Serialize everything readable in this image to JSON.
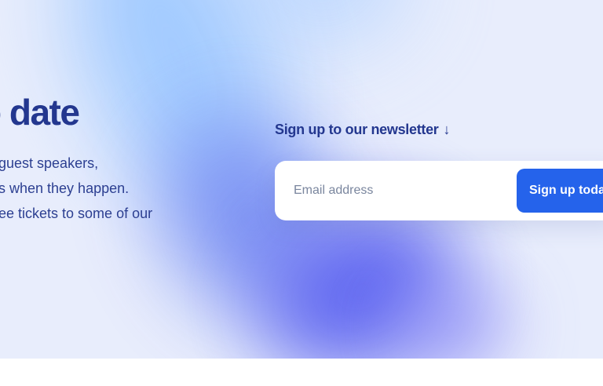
{
  "hero": {
    "headline": "o date",
    "body_lines": [
      "guest speakers,",
      "s when they happen.",
      "ee tickets to some of our"
    ]
  },
  "newsletter": {
    "label": "Sign up to our newsletter",
    "arrow_icon": "arrow-down-icon",
    "arrow_glyph": "↓",
    "email_placeholder": "Email address",
    "email_value": "",
    "button_label": "Sign up toda"
  },
  "colors": {
    "heading": "#23378f",
    "button": "#2563eb",
    "background": "#e8edfc"
  }
}
